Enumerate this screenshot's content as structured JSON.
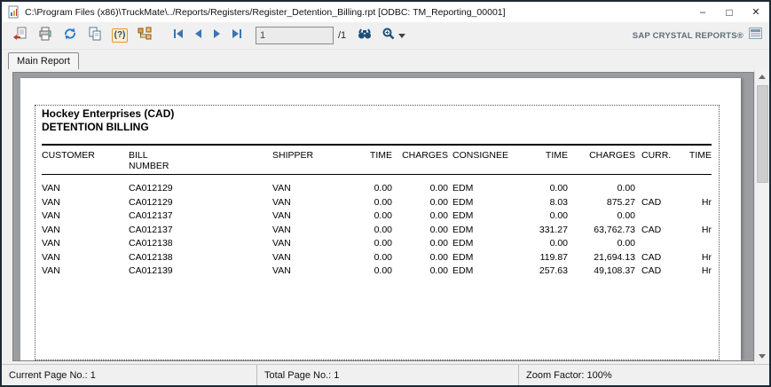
{
  "window": {
    "title": "C:\\Program Files (x86)\\TruckMate\\../Reports/Registers/Register_Detention_Billing.rpt  [ODBC: TM_Reporting_00001]",
    "controls": {
      "minimize": "–",
      "maximize": "□",
      "close": "✕"
    }
  },
  "toolbar": {
    "icons": [
      "export-icon",
      "print-icon",
      "refresh-icon",
      "copy-icon",
      "toggle-parameter-panel-icon",
      "toggle-group-tree-icon",
      "go-first-page-icon",
      "go-previous-page-icon",
      "go-next-page-icon",
      "go-last-page-icon",
      "find-text-icon",
      "zoom-icon"
    ],
    "param_icon_text": "(?)",
    "page_input_value": "1",
    "page_total": "/1",
    "brand": "SAP CRYSTAL REPORTS®"
  },
  "tabs": {
    "main": "Main Report"
  },
  "report": {
    "company": "Hockey Enterprises (CAD)",
    "title": "DETENTION BILLING",
    "columns": [
      "CUSTOMER",
      "BILL\nNUMBER",
      "SHIPPER",
      "TIME",
      "CHARGES",
      "CONSIGNEE",
      "TIME",
      "CHARGES",
      "CURR.",
      "TIME"
    ],
    "rows": [
      {
        "cells": [
          "VAN",
          "CA012129",
          "VAN",
          "0.00",
          "0.00",
          "EDM",
          "0.00",
          "0.00",
          "",
          ""
        ]
      },
      {
        "cells": [
          "VAN",
          "CA012129",
          "VAN",
          "0.00",
          "0.00",
          "EDM",
          "8.03",
          "875.27",
          "CAD",
          "Hr"
        ]
      },
      {
        "cells": [
          "VAN",
          "CA012137",
          "VAN",
          "0.00",
          "0.00",
          "EDM",
          "0.00",
          "0.00",
          "",
          ""
        ]
      },
      {
        "cells": [
          "VAN",
          "CA012137",
          "VAN",
          "0.00",
          "0.00",
          "EDM",
          "331.27",
          "63,762.73",
          "CAD",
          "Hr"
        ]
      },
      {
        "cells": [
          "VAN",
          "CA012138",
          "VAN",
          "0.00",
          "0.00",
          "EDM",
          "0.00",
          "0.00",
          "",
          ""
        ]
      },
      {
        "cells": [
          "VAN",
          "CA012138",
          "VAN",
          "0.00",
          "0.00",
          "EDM",
          "119.87",
          "21,694.13",
          "CAD",
          "Hr"
        ]
      },
      {
        "cells": [
          "VAN",
          "CA012139",
          "VAN",
          "0.00",
          "0.00",
          "EDM",
          "257.63",
          "49,108.37",
          "CAD",
          "Hr"
        ]
      }
    ]
  },
  "status_bar": {
    "current_page": "Current Page No.: 1",
    "total_page": "Total Page No.: 1",
    "zoom": "Zoom Factor: 100%"
  },
  "colors": {
    "nav_blue": "#3a75b0",
    "accent_orange": "#e8a33d",
    "canvas_gray": "#9b9da1",
    "brand_gray": "#5e6d77"
  }
}
